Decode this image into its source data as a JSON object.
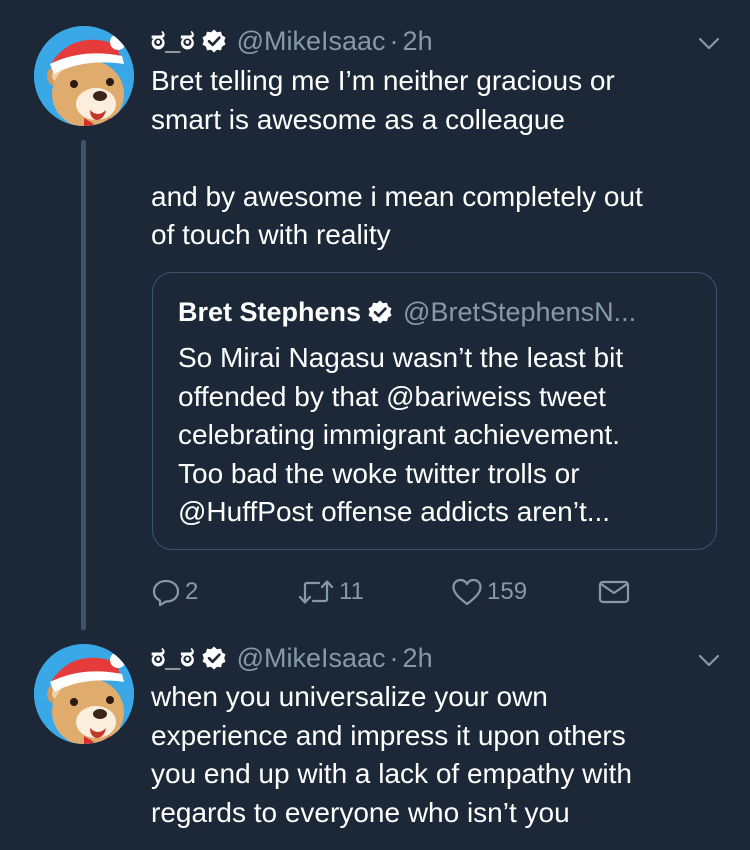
{
  "tweets": [
    {
      "author": {
        "display_name": "ಠ_ಠ",
        "handle": "@MikeIsaac",
        "time": "2h"
      },
      "text": "Bret telling me I’m neither gracious or\nsmart is awesome as a colleague\n\nand by awesome i mean completely out\nof touch with reality",
      "quote": {
        "display_name": "Bret Stephens",
        "handle": "@BretStephensN...",
        "text": "So Mirai Nagasu wasn’t the least bit\noffended by that @bariweiss tweet\ncelebrating immigrant achievement.\nToo bad the woke twitter trolls or\n@HuffPost offense addicts aren’t..."
      },
      "actions": {
        "replies": "2",
        "retweets": "11",
        "likes": "159"
      }
    },
    {
      "author": {
        "display_name": "ಠ_ಠ",
        "handle": "@MikeIsaac",
        "time": "2h"
      },
      "text": "when you universalize your own\nexperience and impress it upon others\nyou end up with a lack of empathy with\nregards to everyone who isn’t you"
    }
  ],
  "separator": "·",
  "icons": {
    "avatar": "bear-santa-hat-icon",
    "verified": "verified-badge-icon",
    "caret": "chevron-down-icon",
    "reply": "reply-icon",
    "retweet": "retweet-icon",
    "like": "heart-icon",
    "dm": "envelope-icon"
  },
  "colors": {
    "background": "#1c2838",
    "text": "#ffffff",
    "secondary": "#8899a6",
    "border": "#3d5466",
    "avatar_bg": "#3aa7e6"
  }
}
